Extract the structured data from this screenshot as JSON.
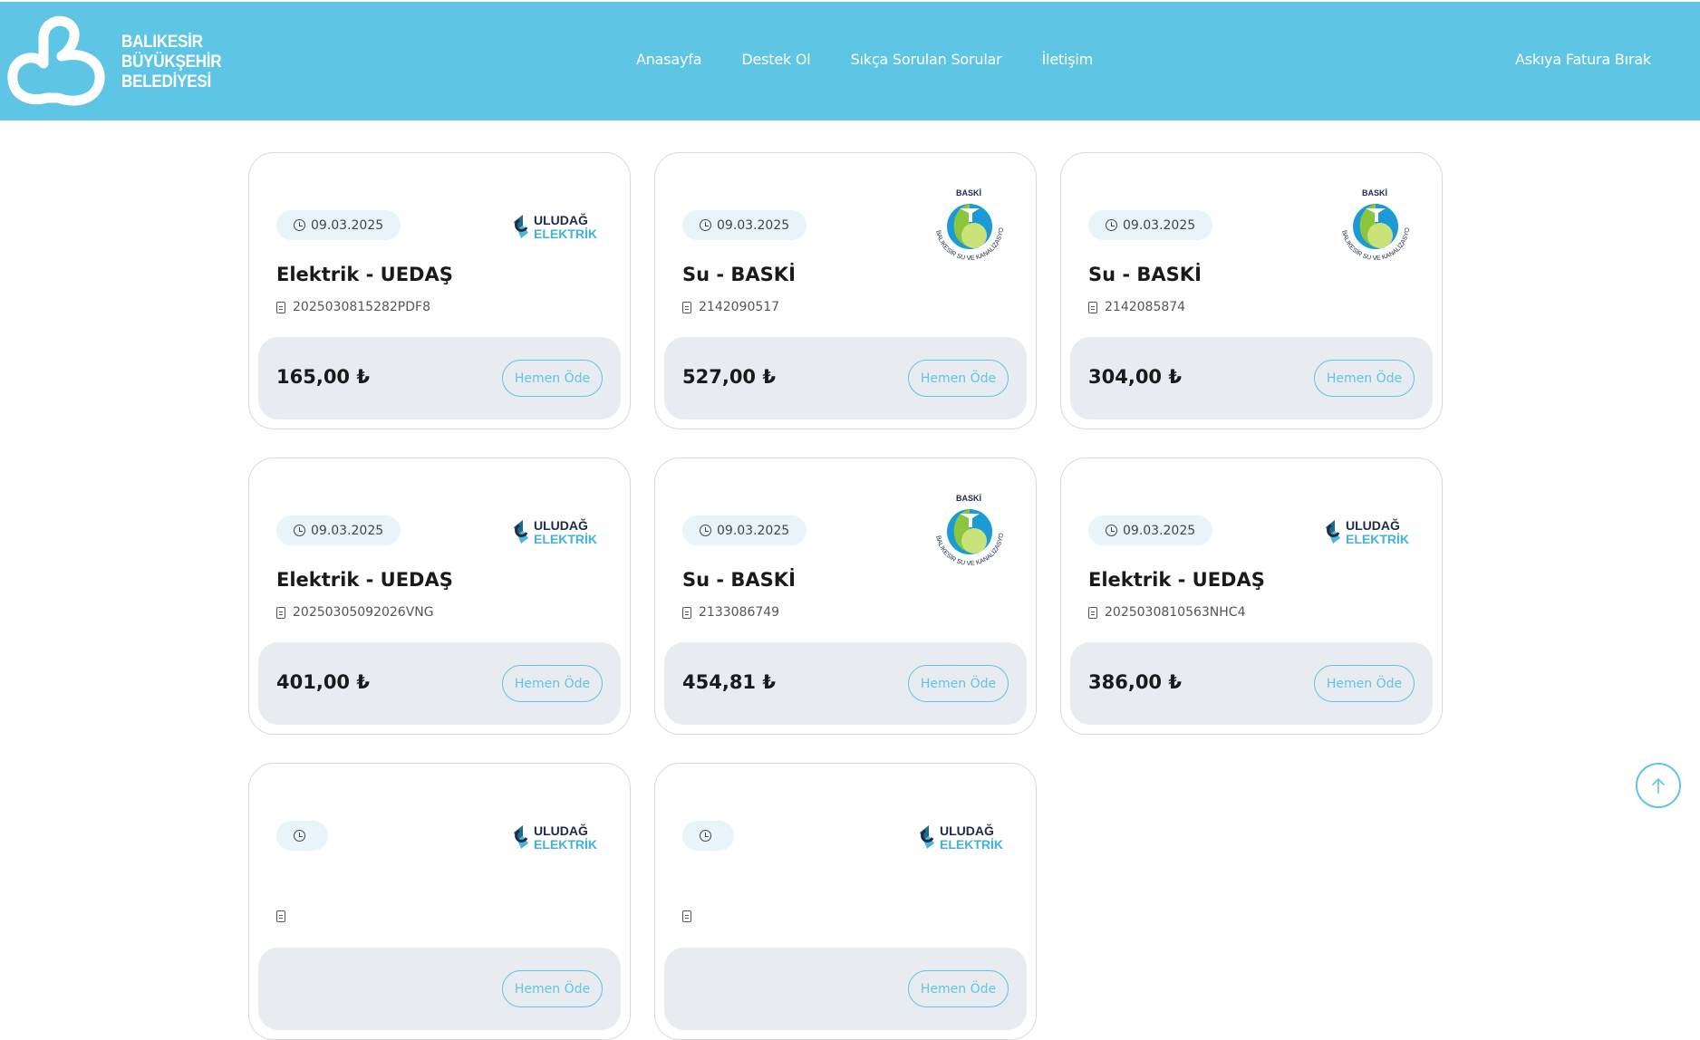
{
  "header": {
    "logo_text_line1": "BALIKESİR",
    "logo_text_line2": "BÜYÜKŞEHİR",
    "logo_text_line3": "BELEDİYESİ",
    "nav": [
      "Anasayfa",
      "Destek Ol",
      "Sıkça Sorulan Sorular",
      "İletişim"
    ],
    "right_link": "Askıya Fatura Bırak"
  },
  "pay_label": "Hemen Öde",
  "cards": [
    {
      "date": "09.03.2025",
      "title": "Elektrik - UEDAŞ",
      "ref": "2025030815282PDF8",
      "amount": "165,00 ₺",
      "provider": "uludag"
    },
    {
      "date": "09.03.2025",
      "title": "Su - BASKİ",
      "ref": "2142090517",
      "amount": "527,00 ₺",
      "provider": "baski"
    },
    {
      "date": "09.03.2025",
      "title": "Su - BASKİ",
      "ref": "2142085874",
      "amount": "304,00 ₺",
      "provider": "baski"
    },
    {
      "date": "09.03.2025",
      "title": "Elektrik - UEDAŞ",
      "ref": "20250305092026VNG",
      "amount": "401,00 ₺",
      "provider": "uludag"
    },
    {
      "date": "09.03.2025",
      "title": "Su - BASKİ",
      "ref": "2133086749",
      "amount": "454,81 ₺",
      "provider": "baski"
    },
    {
      "date": "09.03.2025",
      "title": "Elektrik - UEDAŞ",
      "ref": "2025030810563NHC4",
      "amount": "386,00 ₺",
      "provider": "uludag"
    },
    {
      "date": "",
      "title": "",
      "ref": "",
      "amount": "",
      "provider": "uludag"
    },
    {
      "date": "",
      "title": "",
      "ref": "",
      "amount": "",
      "provider": "uludag"
    }
  ],
  "logos": {
    "uludag_top": "ULUDAĞ",
    "uludag_bottom": "ELEKTRİK",
    "baski_top": "BASKİ",
    "baski_ring": "BALIKESİR SU VE KANALİZASYON İDARESİ"
  },
  "colors": {
    "header": "#5ec5e4",
    "accent": "#5ec5e4",
    "pay_bar": "#e8ebf0"
  }
}
